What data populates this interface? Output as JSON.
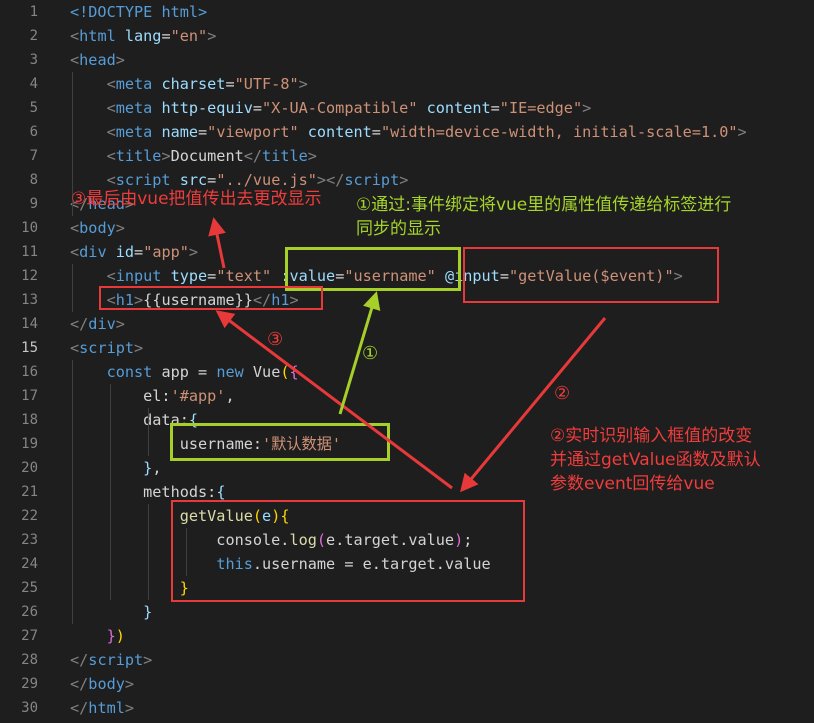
{
  "editor": {
    "active_line": 15,
    "lines": [
      {
        "n": "1",
        "tokens": [
          {
            "t": "<!DOCTYPE ",
            "c": "tag"
          },
          {
            "t": "html",
            "c": "tag"
          },
          {
            "t": ">",
            "c": "tag"
          }
        ]
      },
      {
        "n": "2",
        "tokens": [
          {
            "t": "<",
            "c": "punct"
          },
          {
            "t": "html ",
            "c": "tag"
          },
          {
            "t": "lang",
            "c": "attr"
          },
          {
            "t": "=",
            "c": "plain"
          },
          {
            "t": "\"en\"",
            "c": "str"
          },
          {
            "t": ">",
            "c": "punct"
          }
        ]
      },
      {
        "n": "3",
        "tokens": [
          {
            "t": "<",
            "c": "punct"
          },
          {
            "t": "head",
            "c": "tag"
          },
          {
            "t": ">",
            "c": "punct"
          }
        ]
      },
      {
        "n": "4",
        "tokens": [
          {
            "t": "    <",
            "c": "punct"
          },
          {
            "t": "meta ",
            "c": "tag"
          },
          {
            "t": "charset",
            "c": "attr"
          },
          {
            "t": "=",
            "c": "plain"
          },
          {
            "t": "\"UTF-8\"",
            "c": "str"
          },
          {
            "t": ">",
            "c": "punct"
          }
        ]
      },
      {
        "n": "5",
        "tokens": [
          {
            "t": "    <",
            "c": "punct"
          },
          {
            "t": "meta ",
            "c": "tag"
          },
          {
            "t": "http-equiv",
            "c": "attr"
          },
          {
            "t": "=",
            "c": "plain"
          },
          {
            "t": "\"X-UA-Compatible\" ",
            "c": "str"
          },
          {
            "t": "content",
            "c": "attr"
          },
          {
            "t": "=",
            "c": "plain"
          },
          {
            "t": "\"IE=edge\"",
            "c": "str"
          },
          {
            "t": ">",
            "c": "punct"
          }
        ]
      },
      {
        "n": "6",
        "tokens": [
          {
            "t": "    <",
            "c": "punct"
          },
          {
            "t": "meta ",
            "c": "tag"
          },
          {
            "t": "name",
            "c": "attr"
          },
          {
            "t": "=",
            "c": "plain"
          },
          {
            "t": "\"viewport\" ",
            "c": "str"
          },
          {
            "t": "content",
            "c": "attr"
          },
          {
            "t": "=",
            "c": "plain"
          },
          {
            "t": "\"width=device-width, initial-scale=1.0\"",
            "c": "str"
          },
          {
            "t": ">",
            "c": "punct"
          }
        ]
      },
      {
        "n": "7",
        "tokens": [
          {
            "t": "    <",
            "c": "punct"
          },
          {
            "t": "title",
            "c": "tag"
          },
          {
            "t": ">",
            "c": "punct"
          },
          {
            "t": "Document",
            "c": "plain"
          },
          {
            "t": "</",
            "c": "punct"
          },
          {
            "t": "title",
            "c": "tag"
          },
          {
            "t": ">",
            "c": "punct"
          }
        ]
      },
      {
        "n": "8",
        "tokens": [
          {
            "t": "    <",
            "c": "punct"
          },
          {
            "t": "script ",
            "c": "tag"
          },
          {
            "t": "src",
            "c": "attr"
          },
          {
            "t": "=",
            "c": "plain"
          },
          {
            "t": "\"../vue.js\"",
            "c": "str"
          },
          {
            "t": "></",
            "c": "punct"
          },
          {
            "t": "script",
            "c": "tag"
          },
          {
            "t": ">",
            "c": "punct"
          }
        ]
      },
      {
        "n": "9",
        "tokens": [
          {
            "t": "</",
            "c": "punct"
          },
          {
            "t": "head",
            "c": "tag"
          },
          {
            "t": ">",
            "c": "punct"
          }
        ]
      },
      {
        "n": "10",
        "tokens": [
          {
            "t": "<",
            "c": "punct"
          },
          {
            "t": "body",
            "c": "tag"
          },
          {
            "t": ">",
            "c": "punct"
          }
        ]
      },
      {
        "n": "11",
        "tokens": [
          {
            "t": "<",
            "c": "punct"
          },
          {
            "t": "div ",
            "c": "tag"
          },
          {
            "t": "id",
            "c": "attr"
          },
          {
            "t": "=",
            "c": "plain"
          },
          {
            "t": "\"app\"",
            "c": "str"
          },
          {
            "t": ">",
            "c": "punct"
          }
        ]
      },
      {
        "n": "12",
        "tokens": [
          {
            "t": "    <",
            "c": "punct"
          },
          {
            "t": "input ",
            "c": "tag"
          },
          {
            "t": "type",
            "c": "attr"
          },
          {
            "t": "=",
            "c": "plain"
          },
          {
            "t": "\"text\" ",
            "c": "str"
          },
          {
            "t": ":value",
            "c": "attr"
          },
          {
            "t": "=",
            "c": "plain"
          },
          {
            "t": "\"username\" ",
            "c": "str"
          },
          {
            "t": "@input",
            "c": "attr"
          },
          {
            "t": "=",
            "c": "plain"
          },
          {
            "t": "\"getValue($event)\"",
            "c": "str"
          },
          {
            "t": ">",
            "c": "punct"
          }
        ]
      },
      {
        "n": "13",
        "tokens": [
          {
            "t": "    <",
            "c": "punct"
          },
          {
            "t": "h1",
            "c": "tag"
          },
          {
            "t": ">",
            "c": "punct"
          },
          {
            "t": "{{username}}",
            "c": "plain"
          },
          {
            "t": "</",
            "c": "punct"
          },
          {
            "t": "h1",
            "c": "tag"
          },
          {
            "t": ">",
            "c": "punct"
          }
        ]
      },
      {
        "n": "14",
        "tokens": [
          {
            "t": "</",
            "c": "punct"
          },
          {
            "t": "div",
            "c": "tag"
          },
          {
            "t": ">",
            "c": "punct"
          }
        ]
      },
      {
        "n": "15",
        "tokens": [
          {
            "t": "<",
            "c": "punct"
          },
          {
            "t": "script",
            "c": "tag"
          },
          {
            "t": ">",
            "c": "punct"
          }
        ]
      },
      {
        "n": "16",
        "tokens": [
          {
            "t": "    ",
            "c": "plain"
          },
          {
            "t": "const ",
            "c": "kw"
          },
          {
            "t": "app = ",
            "c": "plain"
          },
          {
            "t": "new ",
            "c": "kw"
          },
          {
            "t": "Vue",
            "c": "plain"
          },
          {
            "t": "(",
            "c": "brace"
          },
          {
            "t": "{",
            "c": "paren"
          }
        ]
      },
      {
        "n": "17",
        "tokens": [
          {
            "t": "        el:",
            "c": "plain"
          },
          {
            "t": "'#app'",
            "c": "str"
          },
          {
            "t": ",",
            "c": "plain"
          }
        ]
      },
      {
        "n": "18",
        "tokens": [
          {
            "t": "        data:",
            "c": "plain"
          },
          {
            "t": "{",
            "c": "prop"
          }
        ]
      },
      {
        "n": "19",
        "tokens": [
          {
            "t": "            username:",
            "c": "plain"
          },
          {
            "t": "'默认数据'",
            "c": "str"
          }
        ]
      },
      {
        "n": "20",
        "tokens": [
          {
            "t": "        ",
            "c": "plain"
          },
          {
            "t": "}",
            "c": "prop"
          },
          {
            "t": ",",
            "c": "plain"
          }
        ]
      },
      {
        "n": "21",
        "tokens": [
          {
            "t": "        methods:",
            "c": "plain"
          },
          {
            "t": "{",
            "c": "prop"
          }
        ]
      },
      {
        "n": "22",
        "tokens": [
          {
            "t": "            ",
            "c": "plain"
          },
          {
            "t": "getValue",
            "c": "fn"
          },
          {
            "t": "(",
            "c": "brace"
          },
          {
            "t": "e",
            "c": "attr"
          },
          {
            "t": ")",
            "c": "brace"
          },
          {
            "t": "{",
            "c": "brace"
          }
        ]
      },
      {
        "n": "23",
        "tokens": [
          {
            "t": "                console.",
            "c": "plain"
          },
          {
            "t": "log",
            "c": "fn"
          },
          {
            "t": "(",
            "c": "paren"
          },
          {
            "t": "e.target.value",
            "c": "plain"
          },
          {
            "t": ")",
            "c": "paren"
          },
          {
            "t": ";",
            "c": "plain"
          }
        ]
      },
      {
        "n": "24",
        "tokens": [
          {
            "t": "                ",
            "c": "plain"
          },
          {
            "t": "this",
            "c": "kw"
          },
          {
            "t": ".username = e.target.value",
            "c": "plain"
          }
        ]
      },
      {
        "n": "25",
        "tokens": [
          {
            "t": "            ",
            "c": "plain"
          },
          {
            "t": "}",
            "c": "brace"
          }
        ]
      },
      {
        "n": "26",
        "tokens": [
          {
            "t": "        ",
            "c": "plain"
          },
          {
            "t": "}",
            "c": "prop"
          }
        ]
      },
      {
        "n": "27",
        "tokens": [
          {
            "t": "    ",
            "c": "plain"
          },
          {
            "t": "}",
            "c": "paren"
          },
          {
            "t": ")",
            "c": "brace"
          }
        ]
      },
      {
        "n": "28",
        "tokens": [
          {
            "t": "</",
            "c": "punct"
          },
          {
            "t": "script",
            "c": "tag"
          },
          {
            "t": ">",
            "c": "punct"
          }
        ]
      },
      {
        "n": "29",
        "tokens": [
          {
            "t": "</",
            "c": "punct"
          },
          {
            "t": "body",
            "c": "tag"
          },
          {
            "t": ">",
            "c": "punct"
          }
        ]
      },
      {
        "n": "30",
        "tokens": [
          {
            "t": "</",
            "c": "punct"
          },
          {
            "t": "html",
            "c": "tag"
          },
          {
            "t": ">",
            "c": "punct"
          }
        ]
      }
    ]
  },
  "annotations": {
    "note_1": "①通过:事件绑定将vue里的属性值传递给标签进行\n同步的显示",
    "note_2": "②实时识别输入框值的改变\n并通过getValue函数及默认\n参数event回传给vue",
    "note_3": "③最后由vue把值传出去更改显示",
    "marker_1": "①",
    "marker_2": "②",
    "marker_3": "③"
  },
  "colors": {
    "background": "#1e1e1e",
    "annotation_red": "#e8393a",
    "annotation_green": "#a6cf2a"
  }
}
